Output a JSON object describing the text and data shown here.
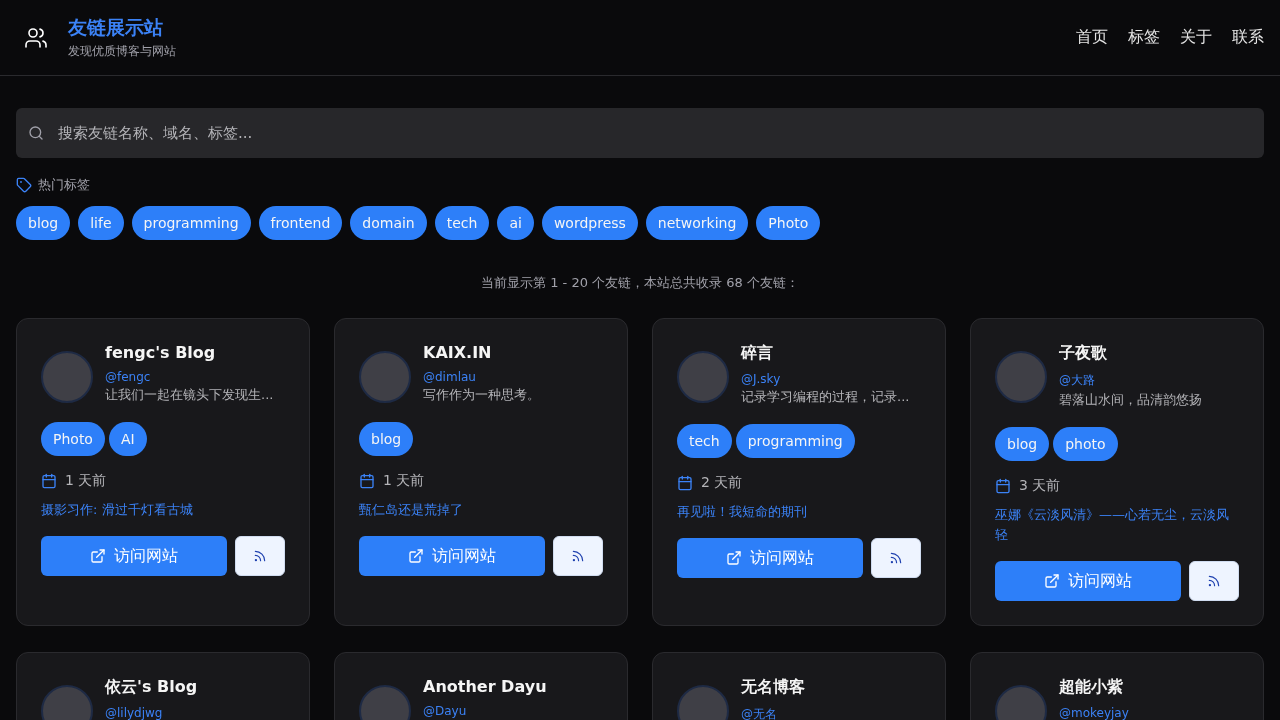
{
  "header": {
    "title": "友链展示站",
    "subtitle": "发现优质博客与网站",
    "nav": [
      {
        "label": "首页"
      },
      {
        "label": "标签"
      },
      {
        "label": "关于"
      },
      {
        "label": "联系"
      }
    ]
  },
  "search": {
    "placeholder": "搜索友链名称、域名、标签..."
  },
  "popular_tags": {
    "title": "热门标签",
    "tags": [
      "blog",
      "life",
      "programming",
      "frontend",
      "domain",
      "tech",
      "ai",
      "wordpress",
      "networking",
      "Photo"
    ]
  },
  "summary": "当前显示第 1 - 20 个友链，本站总共收录 68 个友链：",
  "cards": [
    {
      "name": "fengc's Blog",
      "handle": "@fengc",
      "description": "让我们一起在镜头下发现生...",
      "tags": [
        "Photo",
        "AI"
      ],
      "updated": "1 天前",
      "latest_post": "摄影习作: 滑过千灯看古城",
      "visit_label": "访问网站"
    },
    {
      "name": "KAIX.IN",
      "handle": "@dimlau",
      "description": "写作作为一种思考。",
      "tags": [
        "blog"
      ],
      "updated": "1 天前",
      "latest_post": "甄仁岛还是荒掉了",
      "visit_label": "访问网站"
    },
    {
      "name": "碎言",
      "handle": "@J.sky",
      "description": "记录学习编程的过程，记录...",
      "tags": [
        "tech",
        "programming"
      ],
      "updated": "2 天前",
      "latest_post": "再见啦！我短命的期刊",
      "visit_label": "访问网站"
    },
    {
      "name": "子夜歌",
      "handle": "@大路",
      "description": "碧落山水间，品清韵悠扬",
      "tags": [
        "blog",
        "photo"
      ],
      "updated": "3 天前",
      "latest_post": "巫娜《云淡风清》——心若无尘，云淡风轻",
      "visit_label": "访问网站"
    },
    {
      "name": "依云's Blog",
      "handle": "@lilydjwg"
    },
    {
      "name": "Another Dayu",
      "handle": "@Dayu"
    },
    {
      "name": "无名博客",
      "handle": "@无名"
    },
    {
      "name": "超能小紫",
      "handle": "@mokeyjay"
    }
  ]
}
